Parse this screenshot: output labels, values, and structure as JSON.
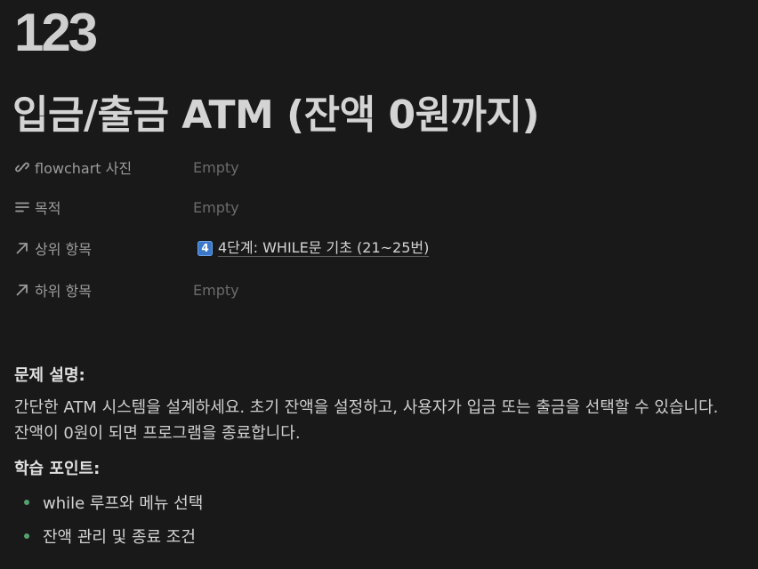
{
  "page": {
    "number": "123",
    "title": "입금/출금 ATM (잔액 0원까지)"
  },
  "properties": [
    {
      "label": "flowchart 사진",
      "icon": "link-icon",
      "value": "Empty"
    },
    {
      "label": "목적",
      "icon": "text-lines-icon",
      "value": "Empty"
    },
    {
      "label": "상위 항목",
      "icon": "arrow-up-right-icon",
      "value": {
        "keycap": "4",
        "text": "4단계: WHILE문 기초",
        "suffix": "(21~25번)"
      }
    },
    {
      "label": "하위 항목",
      "icon": "arrow-up-right-icon",
      "value": "Empty"
    }
  ],
  "content": {
    "problem_heading": "문제 설명:",
    "problem_line1": "간단한 ATM 시스템을 설계하세요. 초기 잔액을 설정하고, 사용자가 입금 또는 출금을 선택할 수 있습니다.",
    "problem_line2": "잔액이 0원이 되면 프로그램을 종료합니다.",
    "learning_heading": "학습 포인트:",
    "bullets": [
      "while 루프와 메뉴 선택",
      "잔액 관리 및 종료 조건"
    ]
  },
  "colors": {
    "background": "#191919",
    "bullet": "#55a16e",
    "keycap": "#3b78c9"
  }
}
